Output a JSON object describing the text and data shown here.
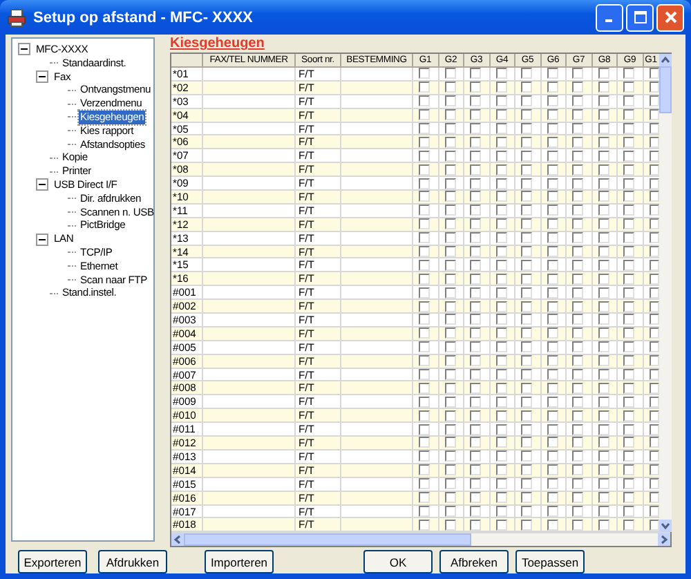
{
  "window": {
    "title": "Setup op afstand - MFC- XXXX"
  },
  "tree": [
    {
      "label": "MFC-XXXX",
      "expanded": true,
      "selected": false,
      "children": [
        {
          "label": "Standaardinst.",
          "selected": false
        },
        {
          "label": "Fax",
          "expanded": true,
          "selected": false,
          "children": [
            {
              "label": "Ontvangstmenu",
              "selected": false
            },
            {
              "label": "Verzendmenu",
              "selected": false
            },
            {
              "label": "Kiesgeheugen",
              "selected": true
            },
            {
              "label": "Kies rapport",
              "selected": false
            },
            {
              "label": "Afstandsopties",
              "selected": false
            }
          ]
        },
        {
          "label": "Kopie",
          "selected": false
        },
        {
          "label": "Printer",
          "selected": false
        },
        {
          "label": "USB Direct I/F",
          "expanded": true,
          "selected": false,
          "children": [
            {
              "label": "Dir. afdrukken",
              "selected": false
            },
            {
              "label": "Scannen n. USB",
              "selected": false
            },
            {
              "label": "PictBridge",
              "selected": false
            }
          ]
        },
        {
          "label": "LAN",
          "expanded": true,
          "selected": false,
          "children": [
            {
              "label": "TCP/IP",
              "selected": false
            },
            {
              "label": "Ethernet",
              "selected": false
            },
            {
              "label": "Scan naar FTP",
              "selected": false
            }
          ]
        },
        {
          "label": "Stand.instel.",
          "selected": false
        }
      ]
    }
  ],
  "panel_title": "Kiesgeheugen",
  "table": {
    "columns": [
      "FAX/TEL NUMMER",
      "Soort nr.",
      "BESTEMMING",
      "G1",
      "G2",
      "G3",
      "G4",
      "G5",
      "G6",
      "G7",
      "G8",
      "G9",
      "G1"
    ],
    "rows": [
      {
        "id": "*01",
        "type": "F/T",
        "groups": [
          false,
          false,
          false,
          false,
          false,
          false,
          false,
          false,
          false,
          false
        ]
      },
      {
        "id": "*02",
        "type": "F/T",
        "groups": [
          false,
          false,
          false,
          false,
          false,
          false,
          false,
          false,
          false,
          false
        ]
      },
      {
        "id": "*03",
        "type": "F/T",
        "groups": [
          false,
          false,
          false,
          false,
          false,
          false,
          false,
          false,
          false,
          false
        ]
      },
      {
        "id": "*04",
        "type": "F/T",
        "groups": [
          false,
          false,
          false,
          false,
          false,
          false,
          false,
          false,
          false,
          false
        ]
      },
      {
        "id": "*05",
        "type": "F/T",
        "groups": [
          false,
          false,
          false,
          false,
          false,
          false,
          false,
          false,
          false,
          false
        ]
      },
      {
        "id": "*06",
        "type": "F/T",
        "groups": [
          false,
          false,
          false,
          false,
          false,
          false,
          false,
          false,
          false,
          false
        ]
      },
      {
        "id": "*07",
        "type": "F/T",
        "groups": [
          false,
          false,
          false,
          false,
          false,
          false,
          false,
          false,
          false,
          false
        ]
      },
      {
        "id": "*08",
        "type": "F/T",
        "groups": [
          false,
          false,
          false,
          false,
          false,
          false,
          false,
          false,
          false,
          false
        ]
      },
      {
        "id": "*09",
        "type": "F/T",
        "groups": [
          false,
          false,
          false,
          false,
          false,
          false,
          false,
          false,
          false,
          false
        ]
      },
      {
        "id": "*10",
        "type": "F/T",
        "groups": [
          false,
          false,
          false,
          false,
          false,
          false,
          false,
          false,
          false,
          false
        ]
      },
      {
        "id": "*11",
        "type": "F/T",
        "groups": [
          false,
          false,
          false,
          false,
          false,
          false,
          false,
          false,
          false,
          false
        ]
      },
      {
        "id": "*12",
        "type": "F/T",
        "groups": [
          false,
          false,
          false,
          false,
          false,
          false,
          false,
          false,
          false,
          false
        ]
      },
      {
        "id": "*13",
        "type": "F/T",
        "groups": [
          false,
          false,
          false,
          false,
          false,
          false,
          false,
          false,
          false,
          false
        ]
      },
      {
        "id": "*14",
        "type": "F/T",
        "groups": [
          false,
          false,
          false,
          false,
          false,
          false,
          false,
          false,
          false,
          false
        ]
      },
      {
        "id": "*15",
        "type": "F/T",
        "groups": [
          false,
          false,
          false,
          false,
          false,
          false,
          false,
          false,
          false,
          false
        ]
      },
      {
        "id": "*16",
        "type": "F/T",
        "groups": [
          false,
          false,
          false,
          false,
          false,
          false,
          false,
          false,
          false,
          false
        ]
      },
      {
        "id": "#001",
        "type": "F/T",
        "groups": [
          false,
          false,
          false,
          false,
          false,
          false,
          false,
          false,
          false,
          false
        ]
      },
      {
        "id": "#002",
        "type": "F/T",
        "groups": [
          false,
          false,
          false,
          false,
          false,
          false,
          false,
          false,
          false,
          false
        ]
      },
      {
        "id": "#003",
        "type": "F/T",
        "groups": [
          false,
          false,
          false,
          false,
          false,
          false,
          false,
          false,
          false,
          false
        ]
      },
      {
        "id": "#004",
        "type": "F/T",
        "groups": [
          false,
          false,
          false,
          false,
          false,
          false,
          false,
          false,
          false,
          false
        ]
      },
      {
        "id": "#005",
        "type": "F/T",
        "groups": [
          false,
          false,
          false,
          false,
          false,
          false,
          false,
          false,
          false,
          false
        ]
      },
      {
        "id": "#006",
        "type": "F/T",
        "groups": [
          false,
          false,
          false,
          false,
          false,
          false,
          false,
          false,
          false,
          false
        ]
      },
      {
        "id": "#007",
        "type": "F/T",
        "groups": [
          false,
          false,
          false,
          false,
          false,
          false,
          false,
          false,
          false,
          false
        ]
      },
      {
        "id": "#008",
        "type": "F/T",
        "groups": [
          false,
          false,
          false,
          false,
          false,
          false,
          false,
          false,
          false,
          false
        ]
      },
      {
        "id": "#009",
        "type": "F/T",
        "groups": [
          false,
          false,
          false,
          false,
          false,
          false,
          false,
          false,
          false,
          false
        ]
      },
      {
        "id": "#010",
        "type": "F/T",
        "groups": [
          false,
          false,
          false,
          false,
          false,
          false,
          false,
          false,
          false,
          false
        ]
      },
      {
        "id": "#011",
        "type": "F/T",
        "groups": [
          false,
          false,
          false,
          false,
          false,
          false,
          false,
          false,
          false,
          false
        ]
      },
      {
        "id": "#012",
        "type": "F/T",
        "groups": [
          false,
          false,
          false,
          false,
          false,
          false,
          false,
          false,
          false,
          false
        ]
      },
      {
        "id": "#013",
        "type": "F/T",
        "groups": [
          false,
          false,
          false,
          false,
          false,
          false,
          false,
          false,
          false,
          false
        ]
      },
      {
        "id": "#014",
        "type": "F/T",
        "groups": [
          false,
          false,
          false,
          false,
          false,
          false,
          false,
          false,
          false,
          false
        ]
      },
      {
        "id": "#015",
        "type": "F/T",
        "groups": [
          false,
          false,
          false,
          false,
          false,
          false,
          false,
          false,
          false,
          false
        ]
      },
      {
        "id": "#016",
        "type": "F/T",
        "groups": [
          false,
          false,
          false,
          false,
          false,
          false,
          false,
          false,
          false,
          false
        ]
      },
      {
        "id": "#017",
        "type": "F/T",
        "groups": [
          false,
          false,
          false,
          false,
          false,
          false,
          false,
          false,
          false,
          false
        ]
      },
      {
        "id": "#018",
        "type": "F/T",
        "groups": [
          false,
          false,
          false,
          false,
          false,
          false,
          false,
          false,
          false,
          false
        ]
      }
    ]
  },
  "buttons": [
    "Exporteren",
    "Afdrukken",
    "Importeren",
    "OK",
    "Afbreken",
    "Toepassen"
  ]
}
